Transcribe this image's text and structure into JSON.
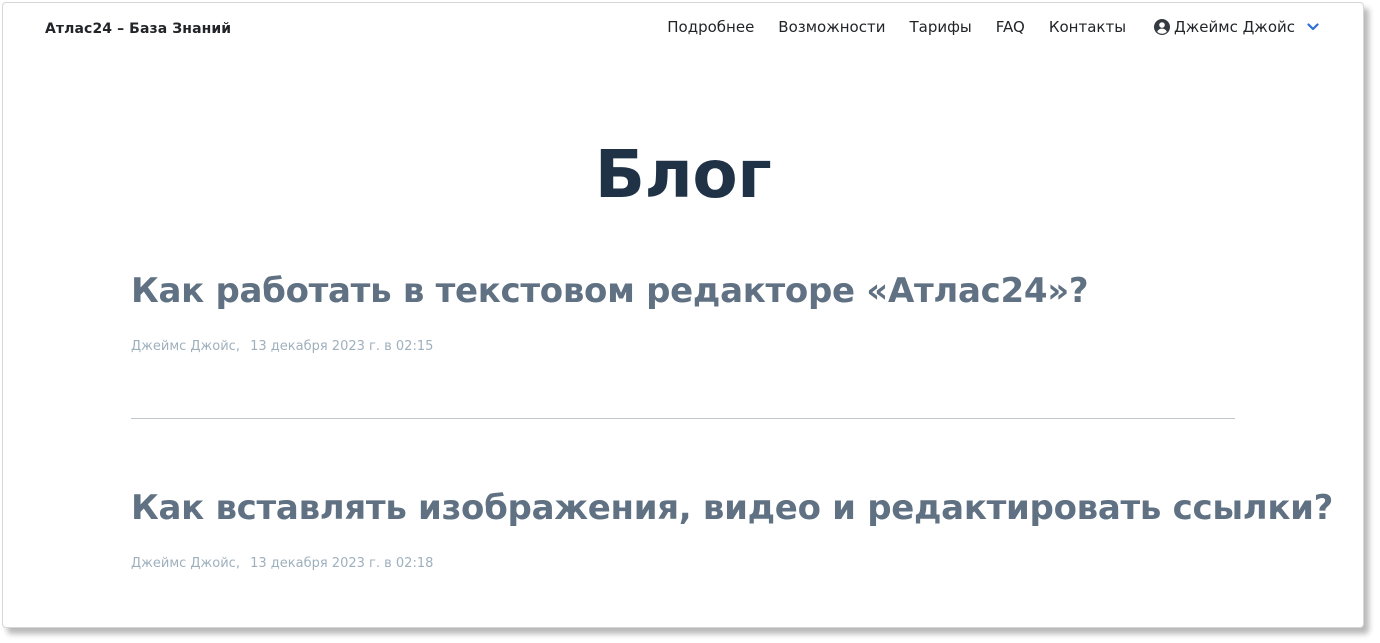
{
  "brand": "Атлас24 – База Знаний",
  "nav": {
    "items": [
      "Подробнее",
      "Возможности",
      "Тарифы",
      "FAQ",
      "Контакты"
    ],
    "user_name": "Джеймс Джойс"
  },
  "page_title": "Блог",
  "posts": [
    {
      "title": "Как работать в текстовом редакторе «Атлас24»?",
      "author": "Джеймс Джойс,",
      "date": "13 декабря 2023 г. в 02:15"
    },
    {
      "title": "Как вставлять изображения, видео и редактировать ссылки?",
      "author": "Джеймс Джойс,",
      "date": "13 декабря 2023 г. в 02:18"
    }
  ],
  "colors": {
    "title": "#1f3246",
    "post_title": "#5f7182",
    "meta": "#9fb0bd",
    "accent": "#2f6fd6"
  },
  "icons": {
    "user": "user-circle-icon",
    "dropdown": "chevron-down-icon"
  }
}
